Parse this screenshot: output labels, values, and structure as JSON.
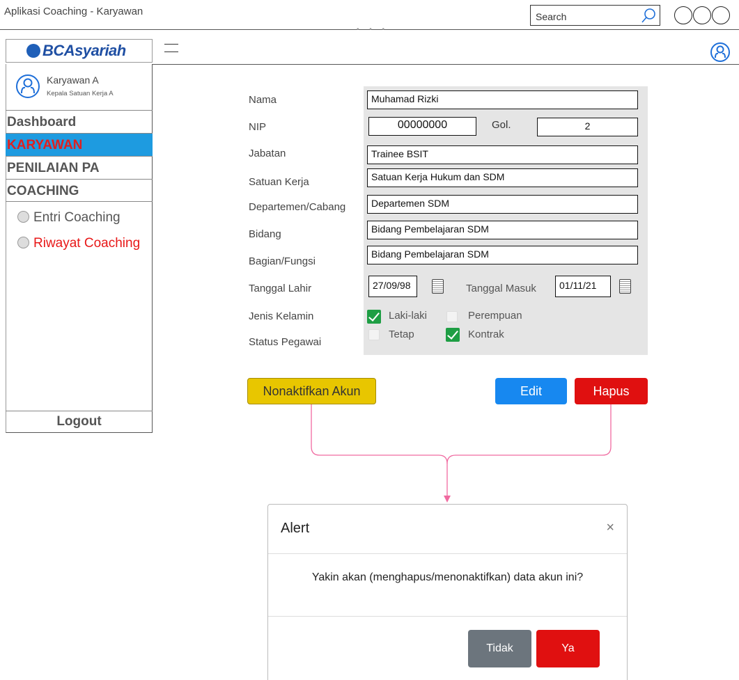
{
  "window": {
    "title": "Aplikasi Coaching - Karyawan",
    "search_placeholder": "Search"
  },
  "brand": {
    "logo_text_bca": "BCA",
    "logo_text_syariah": "syariah"
  },
  "user": {
    "name": "Karyawan A",
    "role": "Kepala Satuan Kerja A"
  },
  "sidebar": {
    "items": [
      {
        "label": "Dashboard"
      },
      {
        "label": "KARYAWAN"
      },
      {
        "label": "PENILAIAN PA"
      },
      {
        "label": "COACHING"
      }
    ],
    "sub_items": [
      {
        "label": "Entri Coaching"
      },
      {
        "label": "Riwayat Coaching"
      }
    ],
    "logout": "Logout"
  },
  "form": {
    "labels": {
      "nama": "Nama",
      "nip": "NIP",
      "gol": "Gol.",
      "jabatan": "Jabatan",
      "satuan_kerja": "Satuan Kerja",
      "departemen": "Departemen/Cabang",
      "bidang": "Bidang",
      "bagian": "Bagian/Fungsi",
      "tanggal_lahir": "Tanggal Lahir",
      "tanggal_masuk": "Tanggal Masuk",
      "jenis_kelamin": "Jenis Kelamin",
      "status_pegawai": "Status Pegawai"
    },
    "values": {
      "nama": "Muhamad Rizki",
      "nip": "00000000",
      "gol": "2",
      "jabatan": "Trainee BSIT",
      "satuan_kerja": "Satuan Kerja Hukum dan SDM",
      "departemen": "Departemen SDM",
      "bidang": "Bidang Pembelajaran SDM",
      "bagian": "Bidang Pembelajaran SDM",
      "tanggal_lahir": "27/09/98",
      "tanggal_masuk": "01/11/21"
    },
    "options": {
      "laki_laki": {
        "label": "Laki-laki",
        "checked": true
      },
      "perempuan": {
        "label": "Perempuan",
        "checked": false
      },
      "tetap": {
        "label": "Tetap",
        "checked": false
      },
      "kontrak": {
        "label": "Kontrak",
        "checked": true
      }
    }
  },
  "buttons": {
    "nonaktifkan": "Nonaktifkan Akun",
    "edit": "Edit",
    "hapus": "Hapus"
  },
  "alert": {
    "title": "Alert",
    "close": "×",
    "message": "Yakin akan (menghapus/menonaktifkan) data akun ini?",
    "tidak": "Tidak",
    "ya": "Ya"
  },
  "colors": {
    "active_nav_bg": "#1e9be0",
    "active_nav_text": "#e02020",
    "flow_line": "#f06aa0",
    "edit": "#1788f0",
    "hapus": "#e01010",
    "nonaktif": "#e8c600",
    "check": "#1e9e44"
  }
}
